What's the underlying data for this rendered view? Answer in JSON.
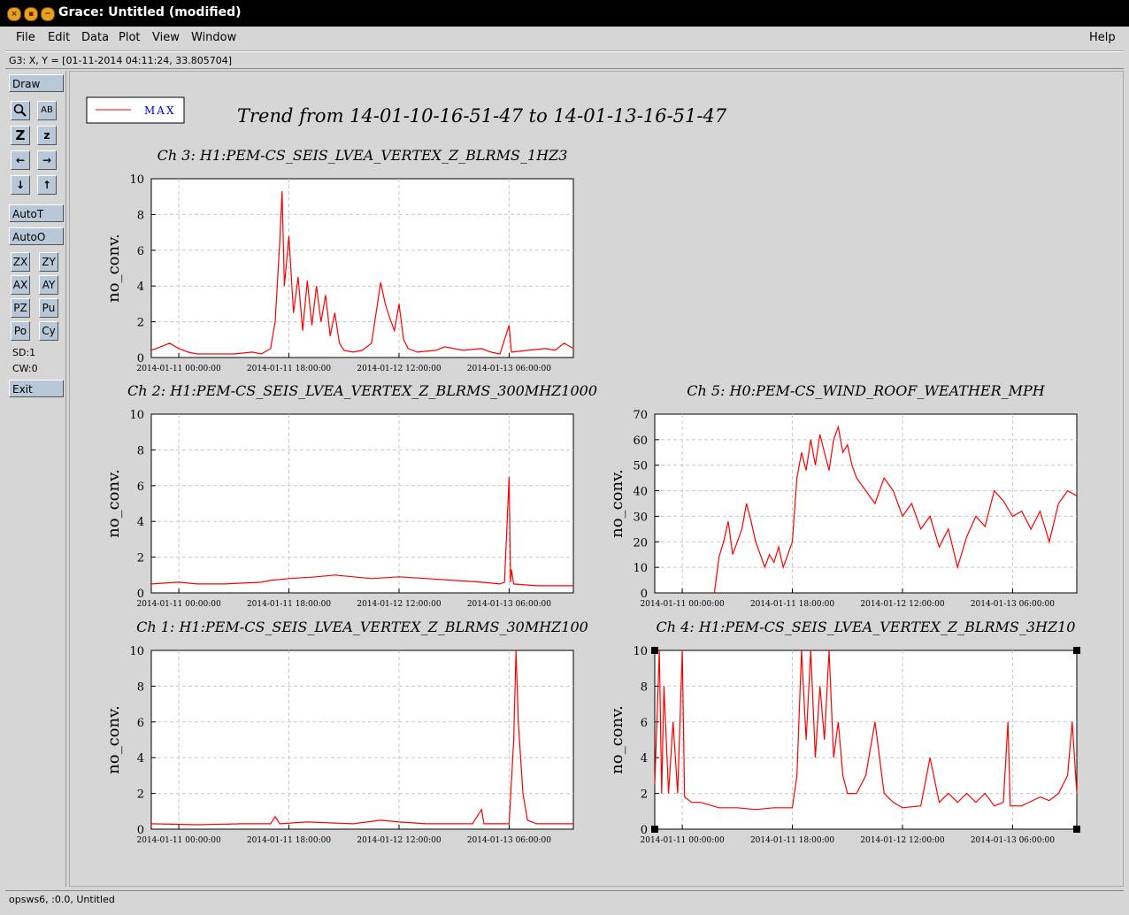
{
  "window": {
    "title": "Grace: Untitled (modified)",
    "title_buttons": [
      "×",
      "▪",
      "−"
    ]
  },
  "menubar": {
    "items": [
      {
        "label": "File"
      },
      {
        "label": "Edit"
      },
      {
        "label": "Data"
      },
      {
        "label": "Plot"
      },
      {
        "label": "View"
      },
      {
        "label": "Window"
      }
    ],
    "help": "Help"
  },
  "coordinates": "G3: X, Y = [01-11-2014 04:11:24, 33.805704]",
  "toolbar": {
    "draw": "Draw",
    "zoom_icon": "magnifier-icon",
    "text_icon": "AB",
    "zoom_z_big": "Z",
    "zoom_z_small": "z",
    "left": "←",
    "right": "→",
    "down": "↓",
    "up": "↑",
    "autot": "AutoT",
    "autoo": "AutoO",
    "zx": "ZX",
    "zy": "ZY",
    "ax": "AX",
    "ay": "AY",
    "pz": "PZ",
    "pu": "Pu",
    "po": "Po",
    "cy": "Cy",
    "sd": "SD:1",
    "cw": "CW:0",
    "exit": "Exit"
  },
  "statusbar": "opsws6, :0.0, Untitled",
  "colors": {
    "series": "#ff0000",
    "legend_text": "#0000cc",
    "grid": "#c8c8c8"
  },
  "legend": {
    "label": "MAX"
  },
  "main_title": "Trend from 14-01-10-16-51-47 to 14-01-13-16-51-47",
  "chart_data": [
    {
      "type": "line",
      "title": "Ch 3: H1:PEM-CS_SEIS_LVEA_VERTEX_Z_BLRMS_1HZ3",
      "ylabel": "no_conv.",
      "yticks": [
        "0",
        "2",
        "4",
        "6",
        "8",
        "10"
      ],
      "ylim": [
        0,
        10
      ],
      "xticks": [
        "2014-01-11 00:00:00",
        "2014-01-11 18:00:00",
        "2014-01-12 12:00:00",
        "2014-01-13 06:00:00"
      ],
      "series": [
        {
          "values": [
            [
              0,
              0.4
            ],
            [
              2,
              0.6
            ],
            [
              4,
              0.8
            ],
            [
              6,
              0.5
            ],
            [
              8,
              0.3
            ],
            [
              10,
              0.2
            ],
            [
              14,
              0.2
            ],
            [
              18,
              0.2
            ],
            [
              22,
              0.3
            ],
            [
              24,
              0.2
            ],
            [
              26,
              0.5
            ],
            [
              27,
              2.0
            ],
            [
              28,
              6.5
            ],
            [
              28.5,
              9.3
            ],
            [
              29,
              4.0
            ],
            [
              30,
              6.8
            ],
            [
              31,
              2.5
            ],
            [
              32,
              4.5
            ],
            [
              33,
              1.5
            ],
            [
              34,
              4.3
            ],
            [
              35,
              1.8
            ],
            [
              36,
              4.0
            ],
            [
              37,
              2.0
            ],
            [
              38,
              3.5
            ],
            [
              39,
              1.2
            ],
            [
              40,
              2.5
            ],
            [
              41,
              0.8
            ],
            [
              42,
              0.4
            ],
            [
              44,
              0.3
            ],
            [
              46,
              0.4
            ],
            [
              48,
              0.8
            ],
            [
              49,
              2.5
            ],
            [
              50,
              4.2
            ],
            [
              51,
              3.0
            ],
            [
              52,
              2.2
            ],
            [
              53,
              1.5
            ],
            [
              54,
              3.0
            ],
            [
              55,
              1.0
            ],
            [
              56,
              0.5
            ],
            [
              58,
              0.3
            ],
            [
              62,
              0.4
            ],
            [
              64,
              0.6
            ],
            [
              68,
              0.4
            ],
            [
              72,
              0.5
            ],
            [
              74,
              0.3
            ],
            [
              76,
              0.2
            ],
            [
              78,
              1.8
            ],
            [
              78.5,
              0.3
            ],
            [
              82,
              0.4
            ],
            [
              86,
              0.5
            ],
            [
              88,
              0.4
            ],
            [
              90,
              0.8
            ],
            [
              92,
              0.5
            ]
          ]
        }
      ]
    },
    {
      "type": "line",
      "title": "Ch 2: H1:PEM-CS_SEIS_LVEA_VERTEX_Z_BLRMS_300MHZ1000",
      "ylabel": "no_conv.",
      "yticks": [
        "0",
        "2",
        "4",
        "6",
        "8",
        "10"
      ],
      "ylim": [
        0,
        10
      ],
      "xticks": [
        "2014-01-11 00:00:00",
        "2014-01-11 18:00:00",
        "2014-01-12 12:00:00",
        "2014-01-13 06:00:00"
      ],
      "series": [
        {
          "values": [
            [
              0,
              0.5
            ],
            [
              6,
              0.6
            ],
            [
              10,
              0.5
            ],
            [
              16,
              0.5
            ],
            [
              24,
              0.6
            ],
            [
              26,
              0.7
            ],
            [
              30,
              0.8
            ],
            [
              36,
              0.9
            ],
            [
              40,
              1.0
            ],
            [
              44,
              0.9
            ],
            [
              48,
              0.8
            ],
            [
              54,
              0.9
            ],
            [
              60,
              0.8
            ],
            [
              66,
              0.7
            ],
            [
              72,
              0.6
            ],
            [
              76,
              0.5
            ],
            [
              77,
              0.6
            ],
            [
              78,
              6.5
            ],
            [
              78.3,
              0.6
            ],
            [
              78.5,
              1.3
            ],
            [
              79,
              0.5
            ],
            [
              84,
              0.4
            ],
            [
              88,
              0.4
            ],
            [
              92,
              0.4
            ]
          ]
        }
      ]
    },
    {
      "type": "line",
      "title": "Ch 5: H0:PEM-CS_WIND_ROOF_WEATHER_MPH",
      "ylabel": "no_conv.",
      "yticks": [
        "0",
        "10",
        "20",
        "30",
        "40",
        "50",
        "60",
        "70"
      ],
      "ylim": [
        0,
        70
      ],
      "xticks": [
        "2014-01-11 00:00:00",
        "2014-01-11 18:00:00",
        "2014-01-12 12:00:00",
        "2014-01-13 06:00:00"
      ],
      "series": [
        {
          "values": [
            [
              13,
              0
            ],
            [
              14,
              14
            ],
            [
              15,
              20
            ],
            [
              16,
              28
            ],
            [
              17,
              15
            ],
            [
              18,
              20
            ],
            [
              19,
              25
            ],
            [
              20,
              35
            ],
            [
              21,
              28
            ],
            [
              22,
              20
            ],
            [
              23,
              15
            ],
            [
              24,
              10
            ],
            [
              25,
              15
            ],
            [
              26,
              12
            ],
            [
              27,
              18
            ],
            [
              28,
              10
            ],
            [
              29,
              15
            ],
            [
              30,
              20
            ],
            [
              31,
              45
            ],
            [
              32,
              55
            ],
            [
              33,
              48
            ],
            [
              34,
              60
            ],
            [
              35,
              50
            ],
            [
              36,
              62
            ],
            [
              37,
              55
            ],
            [
              38,
              48
            ],
            [
              39,
              60
            ],
            [
              40,
              65
            ],
            [
              41,
              55
            ],
            [
              42,
              58
            ],
            [
              43,
              50
            ],
            [
              44,
              45
            ],
            [
              46,
              40
            ],
            [
              48,
              35
            ],
            [
              50,
              45
            ],
            [
              52,
              40
            ],
            [
              54,
              30
            ],
            [
              56,
              35
            ],
            [
              58,
              25
            ],
            [
              60,
              30
            ],
            [
              62,
              18
            ],
            [
              64,
              25
            ],
            [
              66,
              10
            ],
            [
              68,
              22
            ],
            [
              70,
              30
            ],
            [
              72,
              26
            ],
            [
              74,
              40
            ],
            [
              76,
              36
            ],
            [
              78,
              30
            ],
            [
              80,
              32
            ],
            [
              82,
              25
            ],
            [
              84,
              32
            ],
            [
              86,
              20
            ],
            [
              88,
              35
            ],
            [
              90,
              40
            ],
            [
              92,
              38
            ]
          ]
        }
      ]
    },
    {
      "type": "line",
      "title": "Ch 1: H1:PEM-CS_SEIS_LVEA_VERTEX_Z_BLRMS_30MHZ100",
      "ylabel": "no_conv.",
      "yticks": [
        "0",
        "2",
        "4",
        "6",
        "8",
        "10"
      ],
      "ylim": [
        0,
        10
      ],
      "xticks": [
        "2014-01-11 00:00:00",
        "2014-01-11 18:00:00",
        "2014-01-12 12:00:00",
        "2014-01-13 06:00:00"
      ],
      "series": [
        {
          "values": [
            [
              0,
              0.3
            ],
            [
              10,
              0.25
            ],
            [
              20,
              0.3
            ],
            [
              26,
              0.3
            ],
            [
              27,
              0.7
            ],
            [
              28,
              0.3
            ],
            [
              34,
              0.4
            ],
            [
              44,
              0.3
            ],
            [
              50,
              0.5
            ],
            [
              54,
              0.4
            ],
            [
              60,
              0.3
            ],
            [
              66,
              0.3
            ],
            [
              70,
              0.3
            ],
            [
              72,
              1.1
            ],
            [
              72.5,
              0.3
            ],
            [
              78,
              0.3
            ],
            [
              79,
              5.0
            ],
            [
              79.5,
              10
            ],
            [
              80,
              6.0
            ],
            [
              81,
              2.0
            ],
            [
              82,
              0.5
            ],
            [
              84,
              0.3
            ],
            [
              88,
              0.3
            ],
            [
              92,
              0.3
            ]
          ]
        }
      ]
    },
    {
      "type": "line",
      "title": "Ch 4: H1:PEM-CS_SEIS_LVEA_VERTEX_Z_BLRMS_3HZ10",
      "ylabel": "no_conv.",
      "yticks": [
        "0",
        "2",
        "4",
        "6",
        "8",
        "10"
      ],
      "ylim": [
        0,
        10
      ],
      "xticks": [
        "2014-01-11 00:00:00",
        "2014-01-11 18:00:00",
        "2014-01-12 12:00:00",
        "2014-01-13 06:00:00"
      ],
      "series": [
        {
          "values": [
            [
              0,
              2.5
            ],
            [
              1,
              10
            ],
            [
              1.5,
              2
            ],
            [
              2,
              8
            ],
            [
              3,
              2
            ],
            [
              4,
              6
            ],
            [
              5,
              2
            ],
            [
              6,
              10
            ],
            [
              6.5,
              1.8
            ],
            [
              8,
              1.5
            ],
            [
              10,
              1.5
            ],
            [
              14,
              1.2
            ],
            [
              18,
              1.2
            ],
            [
              22,
              1.1
            ],
            [
              26,
              1.2
            ],
            [
              30,
              1.2
            ],
            [
              31,
              3
            ],
            [
              32,
              10
            ],
            [
              33,
              5
            ],
            [
              34,
              10
            ],
            [
              35,
              4
            ],
            [
              36,
              8
            ],
            [
              37,
              5
            ],
            [
              38,
              10
            ],
            [
              39,
              4
            ],
            [
              40,
              6
            ],
            [
              41,
              3
            ],
            [
              42,
              2
            ],
            [
              44,
              2
            ],
            [
              46,
              3
            ],
            [
              48,
              6
            ],
            [
              49,
              4
            ],
            [
              50,
              2
            ],
            [
              52,
              1.5
            ],
            [
              54,
              1.2
            ],
            [
              58,
              1.3
            ],
            [
              60,
              4
            ],
            [
              62,
              1.5
            ],
            [
              64,
              2
            ],
            [
              66,
              1.5
            ],
            [
              68,
              2
            ],
            [
              70,
              1.5
            ],
            [
              72,
              2
            ],
            [
              74,
              1.3
            ],
            [
              76,
              1.5
            ],
            [
              77,
              6
            ],
            [
              77.5,
              1.3
            ],
            [
              80,
              1.3
            ],
            [
              84,
              1.8
            ],
            [
              86,
              1.6
            ],
            [
              88,
              2
            ],
            [
              90,
              3
            ],
            [
              91,
              6
            ],
            [
              92,
              2
            ]
          ]
        }
      ]
    }
  ]
}
